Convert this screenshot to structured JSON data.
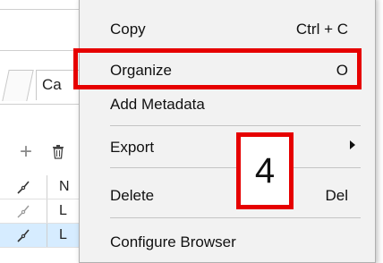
{
  "background": {
    "tab_label": "Ca",
    "rows": [
      {
        "label": "N",
        "selected": false
      },
      {
        "label": "L",
        "selected": false
      },
      {
        "label": "L",
        "selected": true
      }
    ]
  },
  "menu": {
    "items": [
      {
        "label": "Copy",
        "shortcut": "Ctrl + C"
      },
      {
        "label": "Organize",
        "shortcut": "O"
      },
      {
        "label": "Add Metadata",
        "shortcut": ""
      },
      {
        "label": "Export",
        "shortcut": "",
        "submenu": true
      },
      {
        "label": "Delete",
        "shortcut": "Del"
      },
      {
        "label": "Configure Browser",
        "shortcut": ""
      }
    ]
  },
  "annotation": {
    "badge_number": "4",
    "highlight_color": "#e60000"
  },
  "colors": {
    "menu_bg": "#f2f2f2",
    "selected_row": "#d6ecff"
  }
}
